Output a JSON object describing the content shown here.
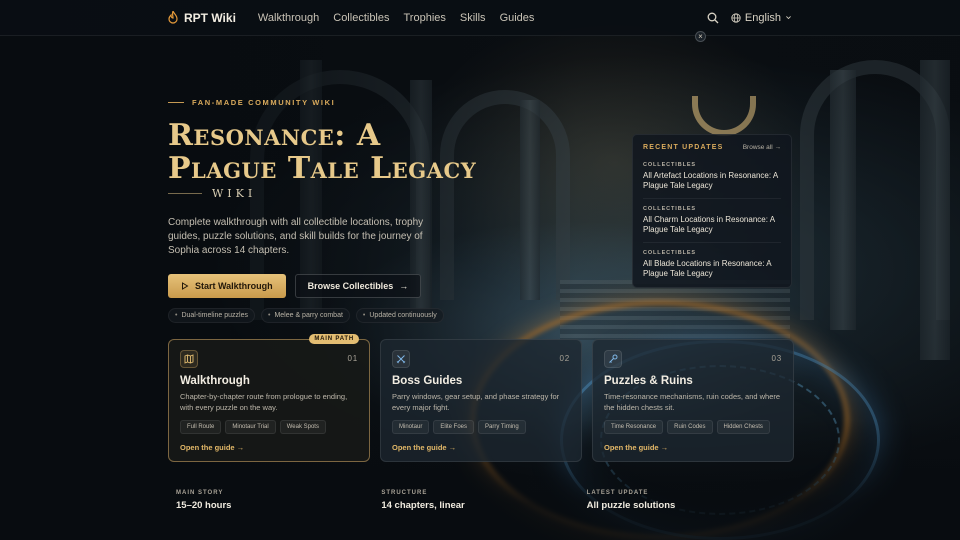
{
  "nav": {
    "brand": "RPT Wiki",
    "links": [
      "Walkthrough",
      "Collectibles",
      "Trophies",
      "Skills",
      "Guides"
    ],
    "language": "English"
  },
  "hero": {
    "eyebrow": "FAN-MADE COMMUNITY WIKI",
    "title_line1": "Resonance: A",
    "title_line2": "Plague Tale Legacy",
    "wiki_label": "WIKI",
    "description": "Complete walkthrough with all collectible locations, trophy guides, puzzle solutions, and skill builds for the journey of Sophia across 14 chapters.",
    "primary_cta": "Start Walkthrough",
    "secondary_cta": "Browse Collectibles",
    "chips": [
      "Dual-timeline puzzles",
      "Melee & parry combat",
      "Updated continuously"
    ]
  },
  "updates": {
    "title": "RECENT UPDATES",
    "browse": "Browse all",
    "items": [
      {
        "category": "COLLECTIBLES",
        "name": "All Artefact Locations in Resonance: A Plague Tale Legacy"
      },
      {
        "category": "COLLECTIBLES",
        "name": "All Charm Locations in Resonance: A Plague Tale Legacy"
      },
      {
        "category": "COLLECTIBLES",
        "name": "All Blade Locations in Resonance: A Plague Tale Legacy"
      }
    ]
  },
  "cards": [
    {
      "num": "01",
      "badge": "MAIN PATH",
      "title": "Walkthrough",
      "desc": "Chapter-by-chapter route from prologue to ending, with every puzzle on the way.",
      "tags": [
        "Full Route",
        "Minotaur Trial",
        "Weak Spots"
      ],
      "link": "Open the guide",
      "icon": "map-icon"
    },
    {
      "num": "02",
      "title": "Boss Guides",
      "desc": "Parry windows, gear setup, and phase strategy for every major fight.",
      "tags": [
        "Minotaur",
        "Elite Foes",
        "Parry Timing"
      ],
      "link": "Open the guide",
      "icon": "crossed-swords-icon"
    },
    {
      "num": "03",
      "title": "Puzzles & Ruins",
      "desc": "Time-resonance mechanisms, ruin codes, and where the hidden chests sit.",
      "tags": [
        "Time Resonance",
        "Ruin Codes",
        "Hidden Chests"
      ],
      "link": "Open the guide",
      "icon": "key-icon"
    }
  ],
  "stats": [
    {
      "label": "MAIN STORY",
      "value": "15–20 hours"
    },
    {
      "label": "STRUCTURE",
      "value": "14 chapters, linear"
    },
    {
      "label": "LATEST UPDATE",
      "value": "All puzzle solutions"
    }
  ],
  "colors": {
    "accent": "#e3bd72",
    "bg": "#0b1016",
    "link": "#e3b868"
  }
}
